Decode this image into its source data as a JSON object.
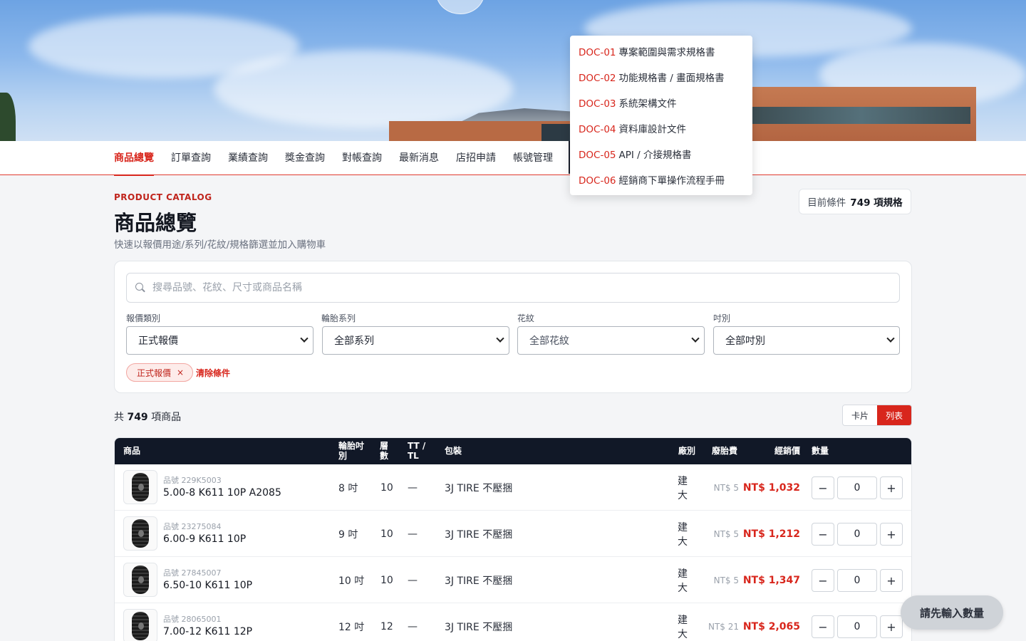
{
  "nav": {
    "items": [
      "商品總覽",
      "訂單查詢",
      "業績查詢",
      "獎金查詢",
      "對帳查詢",
      "最新消息",
      "店招申請",
      "帳號管理"
    ]
  },
  "dropdown": {
    "items": [
      {
        "code": "DOC-01",
        "label": "專案範圍與需求規格書"
      },
      {
        "code": "DOC-02",
        "label": "功能規格書 / 畫面規格書"
      },
      {
        "code": "DOC-03",
        "label": "系統架構文件"
      },
      {
        "code": "DOC-04",
        "label": "資料庫設計文件"
      },
      {
        "code": "DOC-05",
        "label": "API / 介接規格書"
      },
      {
        "code": "DOC-06",
        "label": "經銷商下單操作流程手冊"
      }
    ]
  },
  "header": {
    "kicker": "PRODUCT CATALOG",
    "title": "商品總覽",
    "subtitle": "快速以報價用途/系列/花紋/規格篩選並加入購物車",
    "cond_label": "目前條件",
    "cond_value": "749 項規格"
  },
  "filters": {
    "search_placeholder": "搜尋品號、花紋、尺寸或商品名稱",
    "quote_type_label": "報價類別",
    "quote_type_value": "正式報價",
    "series_label": "輪胎系列",
    "series_value": "全部系列",
    "pattern_label": "花紋",
    "pattern_value": "全部花紋",
    "size_label": "吋別",
    "size_value": "全部吋別",
    "chip_label": "正式報價",
    "chip_close": "×",
    "clear_label": "清除條件"
  },
  "results": {
    "prefix": "共",
    "count": "749",
    "suffix": "項商品",
    "view_card": "卡片",
    "view_list": "列表"
  },
  "table": {
    "headers": {
      "product": "商品",
      "rim": "輪胎吋別",
      "ply": "層數",
      "tt": "TT / TL",
      "pack": "包裝",
      "factory": "廠別",
      "fee": "廢胎費",
      "price": "經銷價",
      "qty": "數量"
    },
    "rows": [
      {
        "sku": "品號 229K5003",
        "name": "5.00-8 K611 10P A2085",
        "rim": "8 吋",
        "ply": "10",
        "tt": "—",
        "pack": "3J TIRE 不壓捆",
        "factory": "建大",
        "fee": "NT$ 5",
        "price": "NT$ 1,032",
        "qty": "0",
        "minus": "−",
        "plus": "+"
      },
      {
        "sku": "品號 23275084",
        "name": "6.00-9 K611 10P",
        "rim": "9 吋",
        "ply": "10",
        "tt": "—",
        "pack": "3J TIRE 不壓捆",
        "factory": "建大",
        "fee": "NT$ 5",
        "price": "NT$ 1,212",
        "qty": "0",
        "minus": "−",
        "plus": "+"
      },
      {
        "sku": "品號 27845007",
        "name": "6.50-10 K611 10P",
        "rim": "10 吋",
        "ply": "10",
        "tt": "—",
        "pack": "3J TIRE 不壓捆",
        "factory": "建大",
        "fee": "NT$ 5",
        "price": "NT$ 1,347",
        "qty": "0",
        "minus": "−",
        "plus": "+"
      },
      {
        "sku": "品號 28065001",
        "name": "7.00-12 K611 12P",
        "rim": "12 吋",
        "ply": "12",
        "tt": "—",
        "pack": "3J TIRE 不壓捆",
        "factory": "建大",
        "fee": "NT$ 21",
        "price": "NT$ 2,065",
        "qty": "0",
        "minus": "−",
        "plus": "+"
      }
    ]
  },
  "float_button": "請先輸入數量",
  "colors": {
    "accent": "#d8261c",
    "table_header": "#111827"
  }
}
